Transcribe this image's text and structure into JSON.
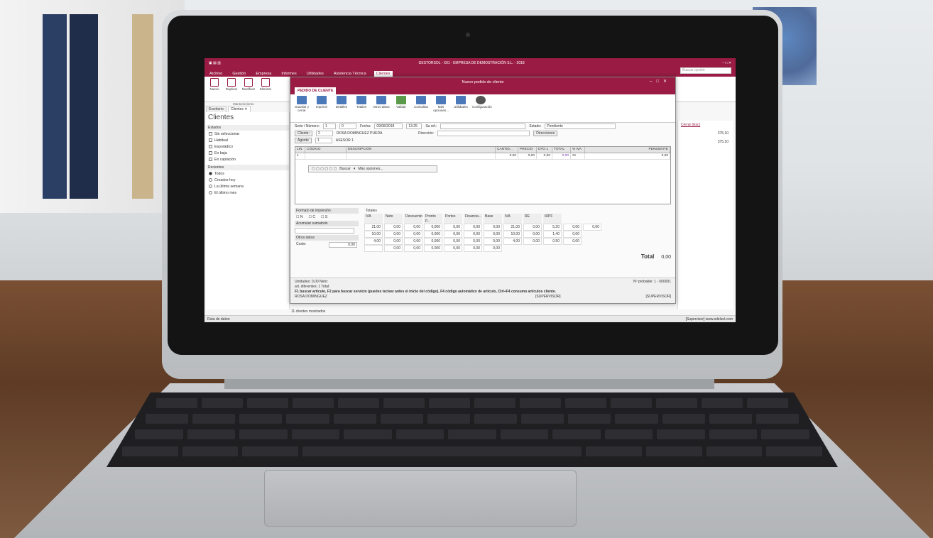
{
  "app": {
    "window_title": "GESTORSOL - X01 - EMPRESA DE DEMOSTRACIÓN S.L. - 2018",
    "context_tab": "Clientes",
    "search_placeholder": "Buscar opción"
  },
  "menu": [
    "Archivo",
    "Gestión",
    "Empresa",
    "Informes",
    "Utilidades",
    "Asistencia Técnica",
    "Clientes"
  ],
  "ribbon": {
    "buttons": [
      "Nuevo",
      "Duplicar",
      "Modificar",
      "Eliminar"
    ],
    "group": "Mantenimiento"
  },
  "doc_tabs": [
    "Escritorio",
    "Clientes ✕"
  ],
  "sidebar": {
    "title": "Clientes",
    "states_header": "Estados",
    "states": [
      "Sin seleccionar",
      "Habitual",
      "Esporádico",
      "En baja",
      "En captación"
    ],
    "recent_header": "Recientes",
    "recent": [
      "Todos",
      "Creados hoy",
      "La última semana",
      "El último mes"
    ]
  },
  "rightpane": {
    "header": "Cerrar (Esc)",
    "values": [
      "375,10",
      "375,10"
    ]
  },
  "statusbar": {
    "left": "Ruta de datos:",
    "count": "11 clientes mostrados",
    "right": "[Supervisor]   www.sdelsol.com"
  },
  "modal": {
    "title": "Nuevo pedido de cliente",
    "tab": "PEDIDO DE CLIENTE",
    "ribbon": {
      "buttons": [
        "Guardar y cerrar",
        "Imprimir",
        "Detalles",
        "Totales",
        "Otros datos",
        "Validar",
        "Consultas",
        "Más opciones...",
        "Utilidades",
        "Configuración"
      ],
      "groups": [
        "Mantenimiento",
        "Emisión",
        "Mostrar",
        "Líneas",
        "Útiles",
        "Configuración"
      ]
    },
    "form": {
      "serie_label": "Serie / Número:",
      "serie_value": "1",
      "numero_value": "0",
      "fecha_label": "Fecha:",
      "fecha_value": "09/08/2018",
      "hora_value": "13:25",
      "suref_label": "Su ref.:",
      "estado_label": "Estado:",
      "estado_value": "Pendiente",
      "cliente_label": "Cliente:",
      "cliente_code": "2",
      "cliente_name": "ROSA DOMINGUEZ PUEDA",
      "direccion_label": "Dirección:",
      "direcciones_button": "Direcciones",
      "agente_label": "Agente",
      "agente_code": "1",
      "agente_name": "ASESOR 1"
    },
    "grid": {
      "columns": [
        "LIN",
        "CÓDIGO",
        "DESCRIPCIÓN",
        "CANTID...",
        "PRECIO",
        "DTO 1",
        "TOTAL",
        "% IVA",
        "PENDIENTE"
      ],
      "rows": [
        [
          "1",
          "",
          "",
          "0,00",
          "0,00",
          "0,00",
          "0,00",
          "21",
          "0,00"
        ]
      ],
      "tools": [
        "Buscar",
        "Más opciones..."
      ]
    },
    "print_format": {
      "header": "Formato de impresión",
      "options": [
        "N",
        "C",
        "S"
      ],
      "accumulate_label": "Acumular sumatorio",
      "other_label": "Otros datos",
      "cost_label": "Coste:",
      "cost_value": "0,00"
    },
    "totals": {
      "header": "Totales",
      "columns": [
        "IVA",
        "Neto",
        "Descuento",
        "Pronto p...",
        "Portes",
        "Financia...",
        "Base",
        "IVA",
        "RE",
        "IRPF"
      ],
      "rows": [
        [
          "21,00",
          "0,00",
          "0,00",
          "0,000",
          "0,00",
          "0,00",
          "0,00",
          "21,00",
          "0,00",
          "5,20",
          "0,00",
          "0,00",
          "0,00"
        ],
        [
          "10,00",
          "0,00",
          "0,00",
          "0,000",
          "0,00",
          "0,00",
          "0,00",
          "10,00",
          "0,00",
          "1,40",
          "0,00"
        ],
        [
          "4,00",
          "0,00",
          "0,00",
          "0,000",
          "0,00",
          "0,00",
          "0,00",
          "4,00",
          "0,00",
          "0,50",
          "0,00"
        ],
        [
          "",
          "0,00",
          "0,00",
          "0,000",
          "0,00",
          "0,00",
          "0,00"
        ]
      ],
      "total_label": "Total",
      "total_value": "0,00"
    },
    "footer": {
      "units": "Unidades:          0,00  Neto:",
      "different": "art. diferentes:          1  Total:",
      "probable": "Nº probable:  1 - 000001",
      "hint": "F1 buscar artículo, F2 para buscar servicio (puedes teclear antes el inicio del código), F4 código automático de artículo, Ctrl+F4 consumo artículos cliente.",
      "client": "ROSA DOMINGUEZ",
      "user1": "[SUPERVISOR]",
      "user2": "[SUPERVISOR]"
    }
  },
  "colors": {
    "accent": "#9a1c45",
    "wall": "#e2e5e7",
    "desk": "#6e4630",
    "laptop": "#c4c6c9"
  }
}
